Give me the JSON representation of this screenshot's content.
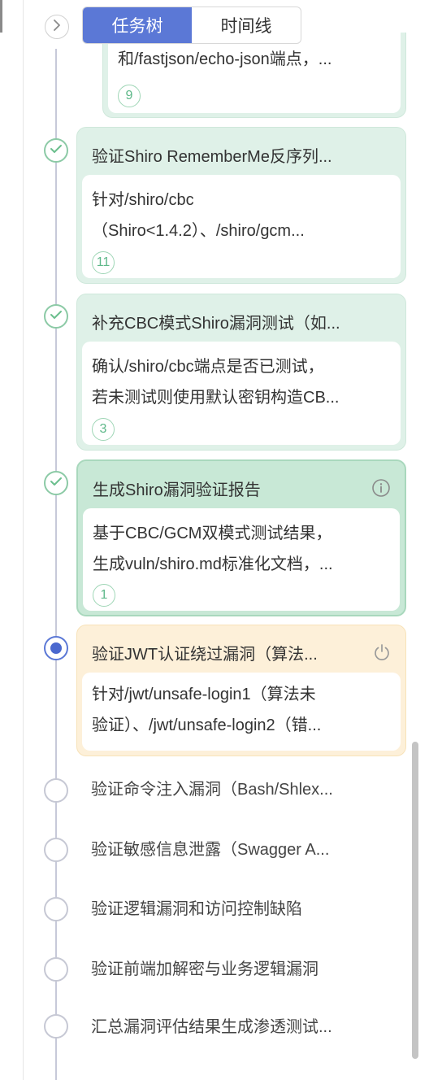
{
  "tabs": [
    {
      "label": "任务树",
      "active": true
    },
    {
      "label": "时间线",
      "active": false
    }
  ],
  "cards": [
    {
      "desc_lines": [
        "和/fastjson/echo-json端点，..."
      ],
      "count": "9"
    },
    {
      "title": "验证Shiro RememberMe反序列...",
      "desc_lines": [
        "针对/shiro/cbc",
        "（Shiro<1.4.2）、/shiro/gcm..."
      ],
      "count": "11",
      "status": "done"
    },
    {
      "title": "补充CBC模式Shiro漏洞测试（如...",
      "desc_lines": [
        "确认/shiro/cbc端点是否已测试，",
        "若未测试则使用默认密钥构造CB..."
      ],
      "count": "3",
      "status": "done"
    },
    {
      "title": "生成Shiro漏洞验证报告",
      "desc_lines": [
        "基于CBC/GCM双模式测试结果，",
        "生成vuln/shiro.md标准化文档，..."
      ],
      "count": "1",
      "status": "done",
      "icon": "info-icon"
    },
    {
      "title": "验证JWT认证绕过漏洞（算法...",
      "desc_lines": [
        "针对/jwt/unsafe-login1（算法未",
        "验证）、/jwt/unsafe-login2（错..."
      ],
      "status": "in-progress",
      "icon": "power-icon"
    }
  ],
  "pending": [
    "验证命令注入漏洞（Bash/Shlex...",
    "验证敏感信息泄露（Swagger A...",
    "验证逻辑漏洞和访问控制缺陷",
    "验证前端加解密与业务逻辑漏洞",
    "汇总漏洞评估结果生成渗透测试..."
  ],
  "colors": {
    "accent": "#5b78d6",
    "done": "#8ccaa6",
    "card_green": "#dff1e8",
    "card_orange": "#fdf0d9"
  }
}
